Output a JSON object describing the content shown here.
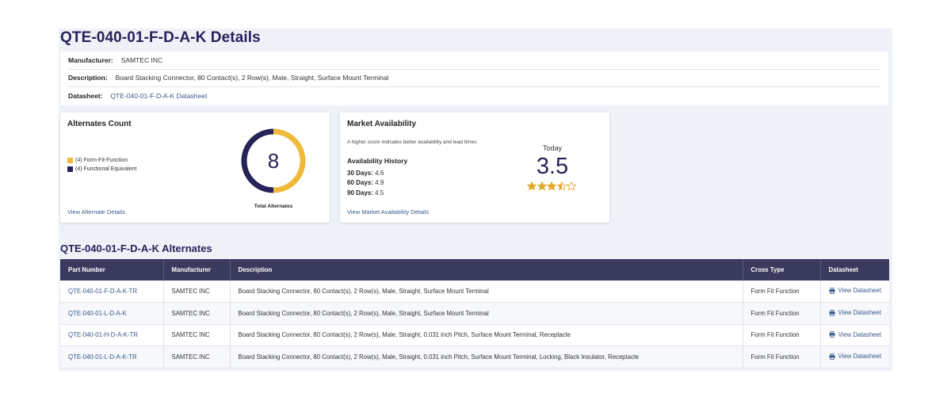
{
  "page_title": "QTE-040-01-F-D-A-K Details",
  "info": {
    "manufacturer_label": "Manufacturer:",
    "manufacturer_value": "SAMTEC INC",
    "description_label": "Description:",
    "description_value": "Board Stacking Connector, 80 Contact(s), 2 Row(s), Male, Straight, Surface Mount Terminal",
    "datasheet_label": "Datasheet:",
    "datasheet_value": "QTE-040-01-F-D-A-K Datasheet"
  },
  "alternates_card": {
    "title": "Alternates Count",
    "legend": [
      {
        "label": "(4) Form-Fit-Function",
        "color": "#f0b93c"
      },
      {
        "label": "(4) Functional Equivalent",
        "color": "#26225a"
      }
    ],
    "total": "8",
    "total_caption": "Total Alternates",
    "link": "View Alternate Details"
  },
  "market_card": {
    "title": "Market Availability",
    "note": "A higher score indicates better availability and lead times.",
    "history_title": "Availability History",
    "history": [
      {
        "label": "30 Days:",
        "value": "4.6"
      },
      {
        "label": "60 Days:",
        "value": "4.9"
      },
      {
        "label": "90 Days:",
        "value": "4.5"
      }
    ],
    "today_label": "Today",
    "today_score": "3.5",
    "rating": 3.5,
    "rating_max": 5,
    "link": "View Market Availability Details"
  },
  "alternates_section_title": "QTE-040-01-F-D-A-K Alternates",
  "table": {
    "headers": [
      "Part Number",
      "Manufacturer",
      "Description",
      "Cross Type",
      "Datasheet"
    ],
    "rows": [
      [
        "QTE-040-01-F-D-A-K-TR",
        "SAMTEC INC",
        "Board Stacking Connector, 80 Contact(s), 2 Row(s), Male, Straight, Surface Mount Terminal",
        "Form Fit Function",
        "View Datasheet"
      ],
      [
        "QTE-040-01-L-D-A-K",
        "SAMTEC INC",
        "Board Stacking Connector, 80 Contact(s), 2 Row(s), Male, Straight, Surface Mount Terminal",
        "Form Fit Function",
        "View Datasheet"
      ],
      [
        "QTE-040-01-H-D-A-K-TR",
        "SAMTEC INC",
        "Board Stacking Connector, 80 Contact(s), 2 Row(s), Male, Straight, 0.031 inch Pitch, Surface Mount Terminal, Receptacle",
        "Form Fit Function",
        "View Datasheet"
      ],
      [
        "QTE-040-01-L-D-A-K-TR",
        "SAMTEC INC",
        "Board Stacking Connector, 80 Contact(s), 2 Row(s), Male, Straight, 0.031 inch Pitch, Surface Mount Terminal, Locking, Black Insulator, Receptacle",
        "Form Fit Function",
        "View Datasheet"
      ]
    ]
  },
  "colors": {
    "accent_dark": "#26225a",
    "accent_gold": "#f0b93c",
    "link": "#3a5a8c",
    "table_header": "#3a3a5e"
  }
}
